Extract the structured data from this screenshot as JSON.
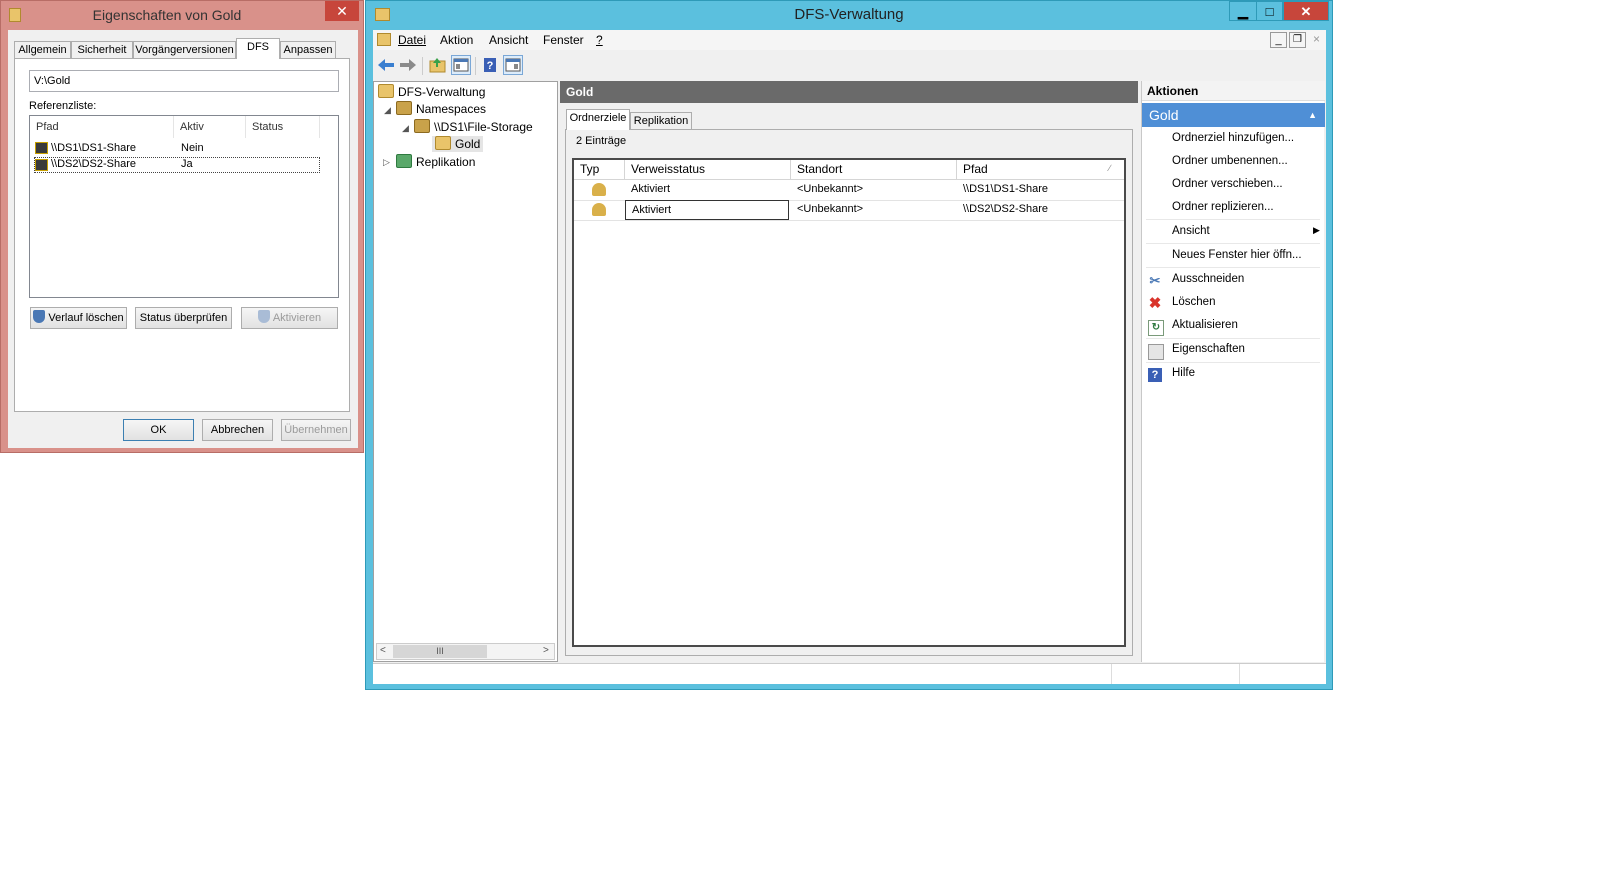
{
  "properties_dialog": {
    "title": "Eigenschaften von Gold",
    "close_glyph": "✕",
    "tabs": [
      "Allgemein",
      "Sicherheit",
      "Vorgängerversionen",
      "DFS",
      "Anpassen"
    ],
    "active_tab": "DFS",
    "path_value": "V:\\Gold",
    "referral_label": "Referenzliste:",
    "columns": [
      "Pfad",
      "Aktiv",
      "Status"
    ],
    "rows": [
      {
        "pfad": "\\\\DS1\\DS1-Share",
        "aktiv": "Nein",
        "status": ""
      },
      {
        "pfad": "\\\\DS2\\DS2-Share",
        "aktiv": "Ja",
        "status": ""
      }
    ],
    "buttons": {
      "clear_history": "Verlauf löschen",
      "check_status": "Status überprüfen",
      "activate": "Aktivieren",
      "ok": "OK",
      "cancel": "Abbrechen",
      "apply": "Übernehmen"
    }
  },
  "dfs_window": {
    "title": "DFS-Verwaltung",
    "caption_glyphs": {
      "minimize": "▁",
      "maximize": "□",
      "close": "✕"
    },
    "inner_caption_glyphs": {
      "minimize": "_",
      "restore": "❐",
      "close": "×"
    },
    "menu": [
      "Datei",
      "Aktion",
      "Ansicht",
      "Fenster",
      "?"
    ],
    "tree": {
      "root": "DFS-Verwaltung",
      "namespaces": "Namespaces",
      "namespace_server": "\\\\DS1\\File-Storage",
      "folder": "Gold",
      "replication": "Replikation",
      "scroll_thumb": "III"
    },
    "center": {
      "header": "Gold",
      "tabs": [
        "Ordnerziele",
        "Replikation"
      ],
      "active_tab": "Ordnerziele",
      "count": "2 Einträge",
      "columns": [
        "Typ",
        "Verweisstatus",
        "Standort",
        "Pfad"
      ],
      "rows": [
        {
          "verweisstatus": "Aktiviert",
          "standort": "<Unbekannt>",
          "pfad": "\\\\DS1\\DS1-Share"
        },
        {
          "verweisstatus": "Aktiviert",
          "standort": "<Unbekannt>",
          "pfad": "\\\\DS2\\DS2-Share"
        }
      ]
    },
    "actions": {
      "header": "Aktionen",
      "section": "Gold",
      "items": [
        "Ordnerziel hinzufügen...",
        "Ordner umbenennen...",
        "Ordner verschieben...",
        "Ordner replizieren...",
        "Ansicht",
        "Neues Fenster hier öffn...",
        "Ausschneiden",
        "Löschen",
        "Aktualisieren",
        "Eigenschaften",
        "Hilfe"
      ]
    },
    "colors": {
      "titlebar": "#5bc0de",
      "dialog_frame": "#d9918a",
      "close_red": "#c7463b",
      "selection_blue": "#cde8ff"
    }
  }
}
